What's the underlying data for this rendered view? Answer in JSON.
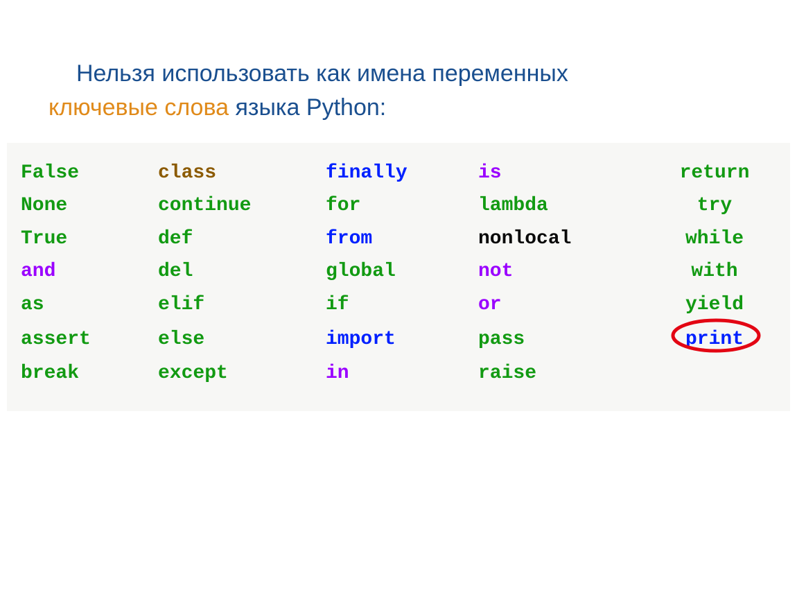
{
  "heading": {
    "line1_indent": "Нельзя использовать как имена переменных",
    "line2_keywords": "ключевые слова",
    "line2_rest": " языка Python:"
  },
  "colors": {
    "green": "#129a12",
    "purple": "#9a00ff",
    "blue": "#0020ff",
    "brown": "#8b5a00",
    "black": "#0a0a0a",
    "heading_blue": "#1a4f8f",
    "heading_orange": "#e08a1a"
  },
  "table": {
    "rows": [
      [
        {
          "text": "False",
          "color": "green"
        },
        {
          "text": "class",
          "color": "brown"
        },
        {
          "text": "finally",
          "color": "blue"
        },
        {
          "text": "is",
          "color": "purple"
        },
        {
          "text": "return",
          "color": "green"
        }
      ],
      [
        {
          "text": "None",
          "color": "green"
        },
        {
          "text": "continue",
          "color": "green"
        },
        {
          "text": "for",
          "color": "green"
        },
        {
          "text": "lambda",
          "color": "green"
        },
        {
          "text": "try",
          "color": "green"
        }
      ],
      [
        {
          "text": "True",
          "color": "green"
        },
        {
          "text": "def",
          "color": "green"
        },
        {
          "text": "from",
          "color": "blue"
        },
        {
          "text": "nonlocal",
          "color": "black"
        },
        {
          "text": "while",
          "color": "green"
        }
      ],
      [
        {
          "text": "and",
          "color": "purple"
        },
        {
          "text": "del",
          "color": "green"
        },
        {
          "text": "global",
          "color": "green"
        },
        {
          "text": "not",
          "color": "purple"
        },
        {
          "text": "with",
          "color": "green"
        }
      ],
      [
        {
          "text": "as",
          "color": "green"
        },
        {
          "text": "elif",
          "color": "green"
        },
        {
          "text": "if",
          "color": "green"
        },
        {
          "text": "or",
          "color": "purple"
        },
        {
          "text": "yield",
          "color": "green"
        }
      ],
      [
        {
          "text": "assert",
          "color": "green"
        },
        {
          "text": "else",
          "color": "green"
        },
        {
          "text": "import",
          "color": "blue"
        },
        {
          "text": "pass",
          "color": "green"
        },
        {
          "text": "print",
          "color": "blue",
          "circled": true
        }
      ],
      [
        {
          "text": "break",
          "color": "green"
        },
        {
          "text": "except",
          "color": "green"
        },
        {
          "text": "in",
          "color": "purple"
        },
        {
          "text": "raise",
          "color": "green"
        },
        {
          "text": "",
          "color": "green"
        }
      ]
    ]
  }
}
